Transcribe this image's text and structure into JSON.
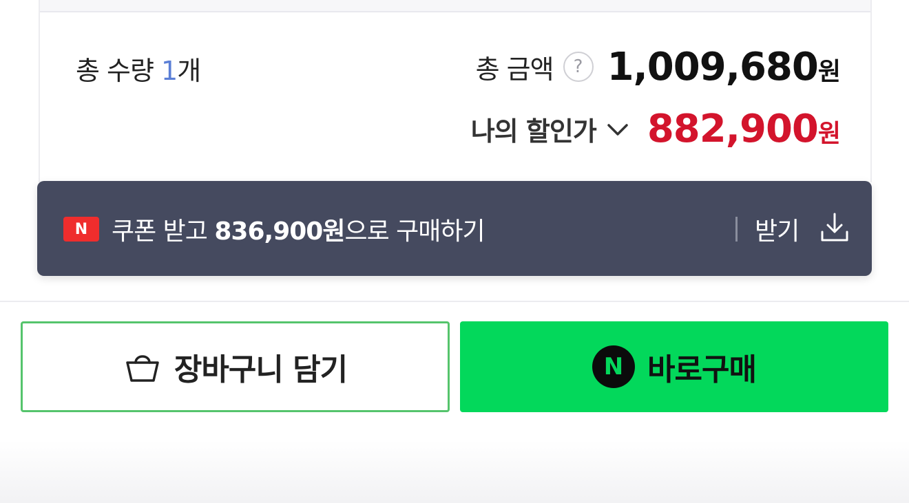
{
  "summary": {
    "total_qty_prefix": "총 수량 ",
    "total_qty_number": "1",
    "total_qty_suffix": "개",
    "total_amount_label": "총 금액",
    "help_glyph": "?",
    "total_amount_value": "1,009,680",
    "currency_unit": "원",
    "discount_label": "나의 할인가",
    "discount_value": "882,900",
    "discount_currency_unit": "원",
    "discount_color": "#d3142c",
    "qty_color": "#5b7fd6"
  },
  "coupon": {
    "badge": "N",
    "text_prefix": "쿠폰 받고 ",
    "amount": "836,900원",
    "text_suffix": "으로 구매하기",
    "receive_label": "받기",
    "bar_color": "#454a5f",
    "icon": "download-icon"
  },
  "actions": {
    "cart_label": "장바구니 담기",
    "cart_icon": "shopping-bag-icon",
    "buy_label": "바로구매",
    "buy_badge": "N",
    "buy_color": "#03d85b",
    "cart_border_color": "#55c46c"
  }
}
